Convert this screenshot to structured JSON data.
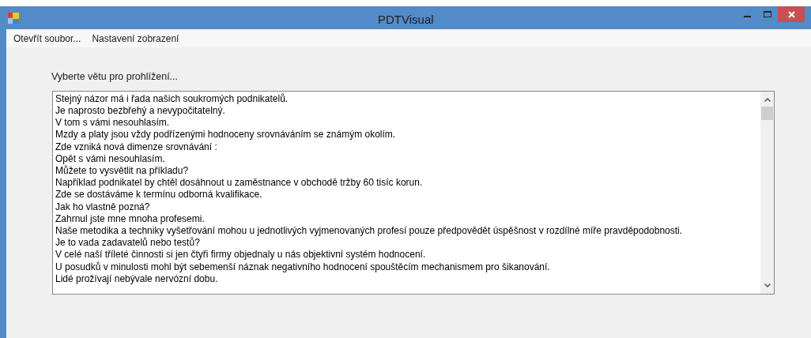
{
  "window": {
    "title": "PDTVisual"
  },
  "menu": [
    {
      "label": "Otevřít soubor..."
    },
    {
      "label": "Nastavení zobrazení"
    }
  ],
  "prompt": "Vyberte větu pro prohlížení...",
  "sentences": [
    "Stejný názor má i řada našich soukromých podnikatelů.",
    "Je naprosto bezbřehý a nevypočitatelný.",
    "V tom s vámi nesouhlasím.",
    "Mzdy a platy jsou vždy podřízenými hodnoceny srovnáváním se známým okolím.",
    "Zde vzniká nová dimenze srovnávání :",
    "Opět s vámi nesouhlasím.",
    "Můžete to vysvětlit na příkladu?",
    "Například podnikatel by chtěl dosáhnout u zaměstnance v obchodě tržby 60 tisíc korun.",
    "Zde se dostáváme k termínu odborná kvalifikace.",
    "Jak ho vlastně pozná?",
    "Zahrnul jste mne mnoha profesemi.",
    "Naše metodika a techniky vyšetřování mohou u jednotlivých vyjmenovaných profesí pouze předpovědět úspěšnost v rozdílné míře pravděpodobnosti.",
    "Je to vada zadavatelů nebo testů?",
    "V celé naší tříleté činnosti si jen čtyři firmy objednaly u nás objektivní systém hodnocení.",
    "U posudků v minulosti mohl být sebemenší náznak negativního hodnocení spouštěcím mechanismem pro šikanování.",
    "Lidé prožívají nebývale nervózní dobu."
  ]
}
